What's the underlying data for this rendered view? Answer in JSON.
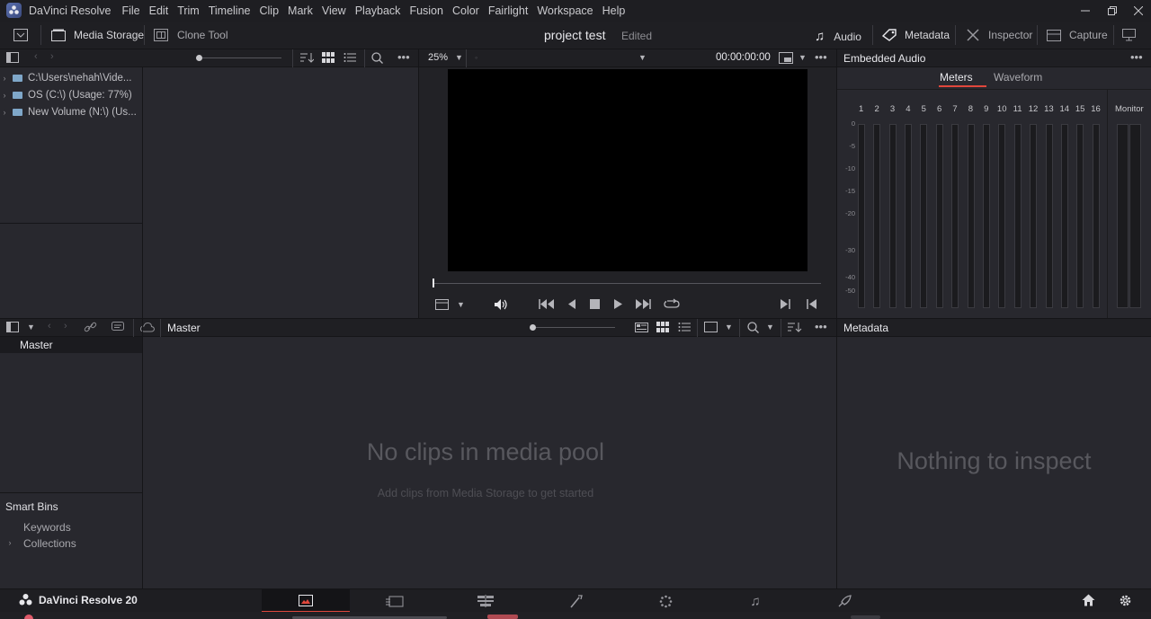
{
  "app": {
    "name": "DaVinci Resolve",
    "menu": [
      "File",
      "Edit",
      "Trim",
      "Timeline",
      "Clip",
      "Mark",
      "View",
      "Playback",
      "Fusion",
      "Color",
      "Fairlight",
      "Workspace",
      "Help"
    ]
  },
  "toolbar": {
    "media_storage": "Media Storage",
    "clone_tool": "Clone Tool",
    "project_title": "project test",
    "project_status": "Edited",
    "audio": "Audio",
    "metadata": "Metadata",
    "inspector": "Inspector",
    "capture": "Capture"
  },
  "storage_tree": [
    "C:\\Users\\nehah\\Vide...",
    "OS (C:\\) (Usage: 77%)",
    "New Volume (N:\\) (Us..."
  ],
  "viewer": {
    "zoom": "25%",
    "timecode": "00:00:00:00"
  },
  "audio_panel": {
    "title": "Embedded Audio",
    "tabs": [
      "Meters",
      "Waveform"
    ],
    "active_tab": "Meters",
    "channels": [
      "1",
      "2",
      "3",
      "4",
      "5",
      "6",
      "7",
      "8",
      "9",
      "10",
      "11",
      "12",
      "13",
      "14",
      "15",
      "16"
    ],
    "monitor_label": "Monitor",
    "scale": [
      "0",
      "-5",
      "-10",
      "-15",
      "-20",
      "-30",
      "-40",
      "-50"
    ]
  },
  "media_pool": {
    "bin_title": "Master",
    "master_bin": "Master",
    "empty_title": "No clips in media pool",
    "empty_hint": "Add clips from Media Storage to get started",
    "smart_bins": "Smart Bins",
    "keywords": "Keywords",
    "collections": "Collections"
  },
  "metadata_panel": {
    "title": "Metadata",
    "empty": "Nothing to inspect"
  },
  "footer": {
    "brand": "DaVinci Resolve 20"
  },
  "colors": {
    "accent_red": "#e0473c",
    "bg": "#28282e"
  }
}
